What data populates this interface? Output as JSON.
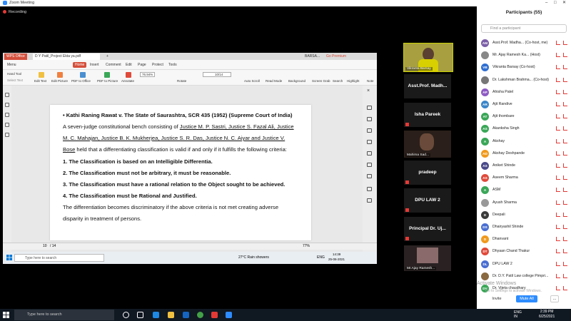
{
  "zoom": {
    "title": "Zoom Meeting",
    "recording": "Recording",
    "controls": [
      "–",
      "□",
      "✕"
    ]
  },
  "wps": {
    "tabs": {
      "office": "WPS Office",
      "doc": "D Y Patil_Project Ekta ya.pdf",
      "add": "+",
      "user": "BARSA...",
      "premium": "Go Premium"
    },
    "menu": {
      "menu": "Menu",
      "home": "Home",
      "insert": "Insert",
      "comment": "Comment",
      "edit": "Edit",
      "page": "Page",
      "protect": "Protect",
      "tools": "Tools"
    },
    "toolbar": {
      "hand_tool": "Hand Tool",
      "select_text": "Select Text",
      "edit_text": "Edit Text",
      "edit_picture": "Edit Picture",
      "pdf_to_office": "PDF to Office",
      "pdf_to_picture": "PDF to Picture",
      "annotate": "Annotate",
      "zoom": "76.94%",
      "rotate": "Rotate",
      "page_input": "10",
      "page_total": "/14",
      "auto_scroll": "Auto Scroll",
      "read_mode": "Read Mode",
      "background": "Background",
      "screen_grab": "Screen Grab",
      "search": "Search",
      "highlight": "Highlight",
      "note": "Note"
    },
    "page_lines": [
      {
        "text": "•  Kathi Raning Rawat v. The State of Saurashtra, SCR 435 (1952) (Supreme Court of India)",
        "style": "bold"
      },
      {
        "text": "A seven-judge constitutional bench consisting of ",
        "u": "Justice M. P. Sastri, Justice S. Fazal Ali, Justice"
      },
      {
        "text": "",
        "u": "M. C. Mahajan, Justice B. K. Mukherjea, Justice S. R. Das, Justice N. C. Aiyar and Justice V."
      },
      {
        "u": "Bose",
        "text": " held that a differentiating classification is valid if and only if it fulfills the following criteria:"
      },
      {
        "text": "1.  The Classification is based on an Intelligible Differentia.",
        "style": "bold"
      },
      {
        "text": "2.  The Classification must not be arbitrary, it must be reasonable.",
        "style": "bold"
      },
      {
        "text": "3.  The Classification must have a rational relation to the Object sought to be achieved.",
        "style": "bold"
      },
      {
        "text": "4.  The Classification must be Rational and Justified.",
        "style": "bold"
      },
      {
        "text": "The differentiation becomes discriminatory if the above criteria is not met creating adverse"
      },
      {
        "text": "disparity in treatment of persons."
      }
    ],
    "status": {
      "page": "10",
      "total": "/ 14",
      "zoom": "77%"
    },
    "inner_taskbar": {
      "search": "Type here to search",
      "weather": "27°C  Rain showers",
      "lang": "ENG",
      "time": "14:39",
      "date": "25-06-2021"
    }
  },
  "tiles": [
    {
      "name": "Vikranta Barsay"
    },
    {
      "label": "Asst.Prof. Madh..."
    },
    {
      "label": "Isha Pareek"
    },
    {
      "label": "",
      "name": "Mahima Sad..."
    },
    {
      "label": "pradeep"
    },
    {
      "label": "DPU LAW 2"
    },
    {
      "label": "Principal  Dr. Uj..."
    },
    {
      "label": "",
      "name": "Mr.Ajay Ramesh..."
    }
  ],
  "participants": {
    "title": "Participants (55)",
    "search_placeholder": "Find a participant",
    "list": [
      {
        "initials": "AM",
        "color": "#7b5ea7",
        "name": "Asst.Prof. Madha...  (Co-host, me)"
      },
      {
        "initials": "",
        "color": "#888888",
        "name": "Mr. Ajay Ramesh Ka...   (Host)"
      },
      {
        "initials": "VB",
        "color": "#2f6fd1",
        "name": "Vikranta Barsay (Co-host)"
      },
      {
        "initials": "",
        "color": "#777777",
        "name": "Dr. Lakshman Brahma...  (Co-host)"
      },
      {
        "initials": "AP",
        "color": "#8e5bc3",
        "name": "Ahisha Patel"
      },
      {
        "initials": "AR",
        "color": "#3a86c9",
        "name": "Ajit Randive"
      },
      {
        "initials": "AT",
        "color": "#3aa757",
        "name": "Ajit thombare"
      },
      {
        "initials": "AS",
        "color": "#3aa757",
        "name": "Akanksha Singh"
      },
      {
        "initials": "A",
        "color": "#3aa757",
        "name": "Akshay"
      },
      {
        "initials": "AD",
        "color": "#f09a1c",
        "name": "Akshay Deshpande"
      },
      {
        "initials": "AS",
        "color": "#4a4a8a",
        "name": "Aniket Shinde"
      },
      {
        "initials": "AS",
        "color": "#e04a3a",
        "name": "Aseem Sharma"
      },
      {
        "initials": "A",
        "color": "#3aa757",
        "name": "ASM"
      },
      {
        "initials": "",
        "color": "#999999",
        "name": "Ayush Sharma"
      },
      {
        "initials": "D",
        "color": "#3a3a3a",
        "name": "Deepali"
      },
      {
        "initials": "DS",
        "color": "#4a6fd1",
        "name": "Dhairyashil Shinde"
      },
      {
        "initials": "D",
        "color": "#f09a1c",
        "name": "Dhanvant"
      },
      {
        "initials": "DT",
        "color": "#e04a3a",
        "name": "Dhyaan Chand Thakur"
      },
      {
        "initials": "DL",
        "color": "#4a6fd1",
        "name": "DPU LAW 2"
      },
      {
        "initials": "",
        "color": "#8a6a40",
        "name": "Dr. D.Y. Patil Law college Pimpri..."
      },
      {
        "initials": "DV",
        "color": "#3aa757",
        "name": "Dr. Vijeta chaudhary"
      }
    ],
    "invite": "Invite",
    "mute_all": "Mute All",
    "more": "...",
    "activate": "Activate Windows",
    "activate2": "Go to Settings to activate Windows."
  },
  "taskbar": {
    "search": "Type here to search",
    "lang": "ENG",
    "region": "IN",
    "time": "2:39 PM",
    "date": "6/25/2021"
  }
}
